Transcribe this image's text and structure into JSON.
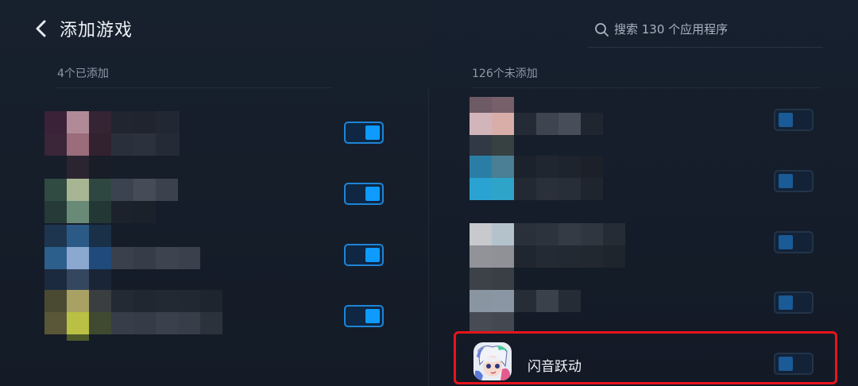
{
  "header": {
    "title": "添加游戏",
    "search_placeholder": "搜索 130 个应用程序"
  },
  "added": {
    "label": "4个已添加",
    "toggles": [
      "on",
      "on",
      "on",
      "on"
    ]
  },
  "not_added": {
    "label": "126个未添加",
    "toggles": [
      "off",
      "off",
      "off",
      "off"
    ],
    "visible_app": {
      "name": "闪音跃动",
      "toggle": "off"
    }
  },
  "colors": {
    "toggle_on": "#0e9bff",
    "toggle_off": "#1a5a96",
    "highlight": "#e8141b"
  }
}
